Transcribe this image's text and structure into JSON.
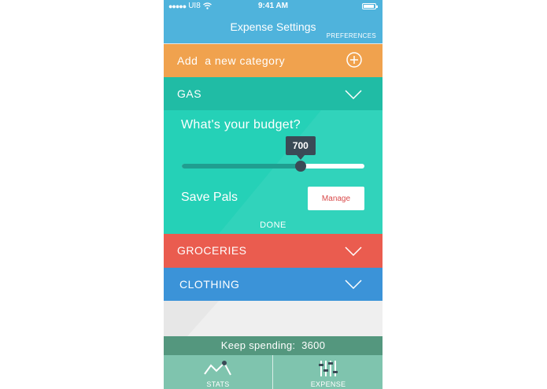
{
  "status": {
    "carrier": "UI8",
    "time": "9:41 AM"
  },
  "header": {
    "title": "Expense Settings",
    "preferences": "PREFERENCES"
  },
  "add_category": {
    "label": "Add  a new category",
    "icon": "plus-circle-icon"
  },
  "categories": [
    {
      "name": "GAS",
      "color": "#20bca5",
      "expanded": true
    },
    {
      "name": "GROCERIES",
      "color": "#ea5c4f",
      "expanded": false
    },
    {
      "name": "CLOTHING",
      "color": "#3b93d8",
      "expanded": false
    }
  ],
  "budget_panel": {
    "question": "What's your budget?",
    "value": "700",
    "slider_fraction": 0.65,
    "save_label": "Save Pals",
    "manage_label": "Manage",
    "done_label": "DONE"
  },
  "summary": {
    "text": "Keep spending:  3600"
  },
  "tabs": [
    {
      "label": "STATS",
      "icon": "stats-line-icon"
    },
    {
      "label": "EXPENSE",
      "icon": "sliders-icon"
    }
  ],
  "colors": {
    "header": "#4fb3dc",
    "add": "#f0a24e",
    "panel": "#25d1b7",
    "summary": "#54977e",
    "tabbar": "#7fc4ae",
    "tooltip": "#3a4a56"
  }
}
